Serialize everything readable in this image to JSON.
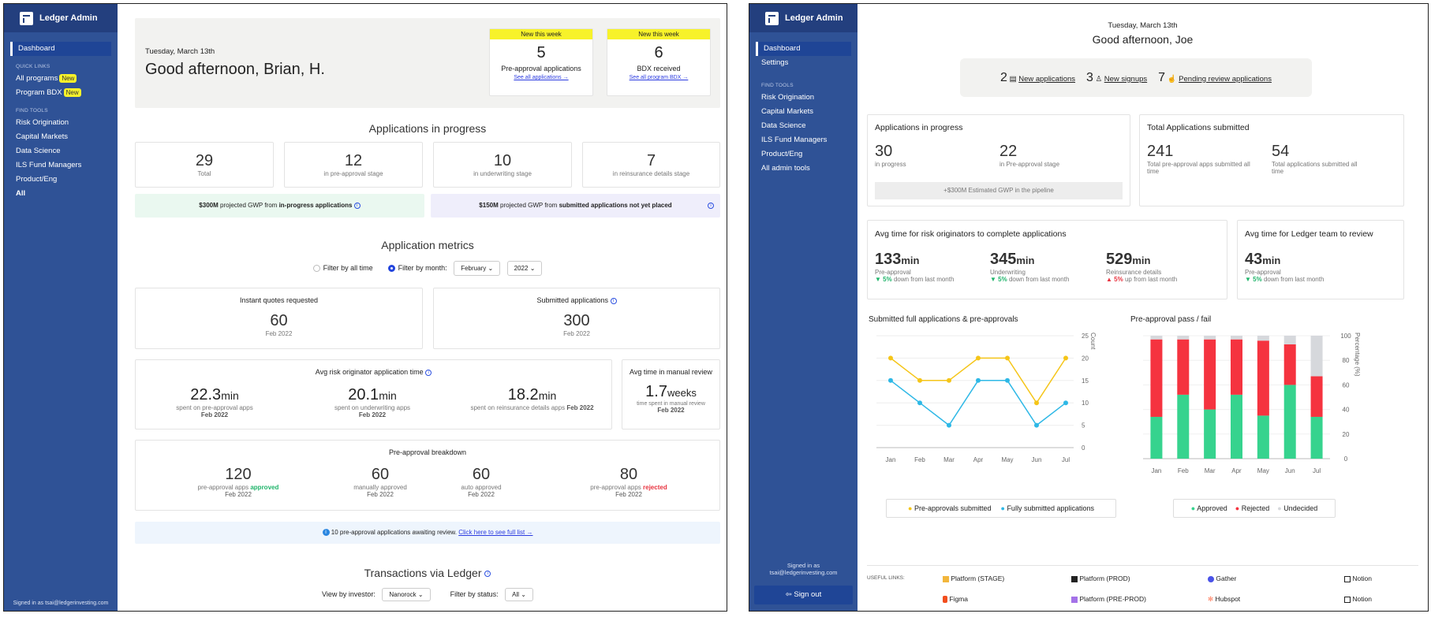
{
  "left": {
    "app_name": "Ledger Admin",
    "nav_dashboard": "Dashboard",
    "quick_links_heading": "QUICK LINKS",
    "quick_links": [
      {
        "label": "All programs",
        "badge": "New"
      },
      {
        "label": "Program BDX",
        "badge": "New"
      }
    ],
    "find_tools_heading": "FIND TOOLS",
    "tools": [
      "Risk Origination",
      "Capital Markets",
      "Data Science",
      "ILS Fund Managers",
      "Product/Eng",
      "All"
    ],
    "signed_in": "Signed in as tsai@ledgerinvesting.com",
    "date": "Tuesday, March 13th",
    "greeting": "Good afternoon, Brian, H.",
    "weekly": [
      {
        "tag": "New this week",
        "value": "5",
        "label": "Pre-approval applications",
        "link": "See all applications →"
      },
      {
        "tag": "New this week",
        "value": "6",
        "label": "BDX received",
        "link": "See all program BDX →"
      }
    ],
    "progress_title": "Applications in progress",
    "progress_stats": [
      {
        "value": "29",
        "label": "Total"
      },
      {
        "value": "12",
        "label": "in pre-approval stage"
      },
      {
        "value": "10",
        "label": "in underwriting stage"
      },
      {
        "value": "7",
        "label": "in reinsurance details stage"
      }
    ],
    "gwp_green": {
      "amount": "$300M",
      "mid": "projected GWP from",
      "bold": "in-progress applications"
    },
    "gwp_purple": {
      "amount": "$150M",
      "mid": "projected GWP from",
      "bold": "submitted applications not yet placed"
    },
    "metrics_title": "Application metrics",
    "filter_all": "Filter by all time",
    "filter_month": "Filter by month:",
    "month_value": "February",
    "year_value": "2022",
    "instant_quotes": {
      "title": "Instant quotes requested",
      "value": "60",
      "period": "Feb 2022"
    },
    "submitted_apps": {
      "title": "Submitted applications",
      "value": "300",
      "period": "Feb 2022"
    },
    "avg_originator": {
      "title": "Avg risk originator application time",
      "items": [
        {
          "value": "22.3",
          "unit": "min",
          "label": "spent on pre-approval apps",
          "period": "Feb 2022"
        },
        {
          "value": "20.1",
          "unit": "min",
          "label": "spent on underwriting apps",
          "period": "Feb 2022"
        },
        {
          "value": "18.2",
          "unit": "min",
          "label": "spent on reinsurance details apps",
          "period": "Feb 2022"
        }
      ]
    },
    "manual_review": {
      "title": "Avg time in manual review",
      "value": "1.7",
      "unit": "weeks",
      "label": "time spent in manual review",
      "period": "Feb 2022"
    },
    "breakdown": {
      "title": "Pre-approval breakdown",
      "items": [
        {
          "value": "120",
          "label": "pre-approval apps",
          "accent": "approved",
          "period": "Feb 2022"
        },
        {
          "value": "60",
          "label": "manually approved",
          "accent": "",
          "period": "Feb 2022"
        },
        {
          "value": "60",
          "label": "auto approved",
          "accent": "",
          "period": "Feb 2022"
        },
        {
          "value": "80",
          "label": "pre-approval apps",
          "accent": "rejected",
          "period": "Feb 2022"
        }
      ]
    },
    "review_notice": "10 pre-approval applications awaiting review.",
    "review_link": "Click here to see full list →",
    "transactions_title": "Transactions via Ledger",
    "view_by_investor": "View by investor:",
    "investor_value": "Nanorock",
    "filter_by_status": "Filter by status:",
    "status_value": "All"
  },
  "right": {
    "app_name": "Ledger Admin",
    "nav": [
      "Dashboard",
      "Settings"
    ],
    "find_tools_heading": "FIND TOOLS",
    "tools": [
      "Risk Origination",
      "Capital Markets",
      "Data Science",
      "ILS Fund Managers",
      "Product/Eng",
      "All admin tools"
    ],
    "signed_in_label": "Signed in as",
    "signed_in_email": "tsai@ledgerinvesting.com",
    "sign_out": "Sign out",
    "date": "Tuesday, March 13th",
    "greeting": "Good afternoon, Joe",
    "pills": [
      {
        "count": "2",
        "label": "New applications"
      },
      {
        "count": "3",
        "label": "New signups"
      },
      {
        "count": "7",
        "label": "Pending review applications"
      }
    ],
    "in_progress": {
      "title": "Applications in progress",
      "stats": [
        {
          "value": "30",
          "label": "in progress"
        },
        {
          "value": "22",
          "label": "in Pre-approval stage"
        }
      ],
      "gwp": "+$300M Estimated GWP in the pipeline"
    },
    "submitted": {
      "title": "Total Applications submitted",
      "stats": [
        {
          "value": "241",
          "label": "Total pre-approval apps submitted all time"
        },
        {
          "value": "54",
          "label": "Total applications submitted all time"
        }
      ]
    },
    "avg_originators": {
      "title": "Avg time for risk originators to complete applications",
      "stats": [
        {
          "value": "133",
          "unit": "min",
          "label": "Pre-approval",
          "change": "5%",
          "dir": "down",
          "note": "down from last month"
        },
        {
          "value": "345",
          "unit": "min",
          "label": "Underwriting",
          "change": "5%",
          "dir": "down",
          "note": "down from last month"
        },
        {
          "value": "529",
          "unit": "min",
          "label": "Reinsurance details",
          "change": "5%",
          "dir": "up",
          "note": "up from last month"
        }
      ]
    },
    "avg_ledger": {
      "title": "Avg time for Ledger team to review",
      "value": "43",
      "unit": "min",
      "label": "Pre-approval",
      "change": "5%",
      "note": "down from last month"
    },
    "useful_links_heading": "USEFUL LINKS:",
    "useful_links": [
      "Platform (STAGE)",
      "Platform (PROD)",
      "Gather",
      "Notion",
      "Figma",
      "Platform (PRE-PROD)",
      "Hubspot",
      "Notion"
    ]
  },
  "chart_data": [
    {
      "type": "line",
      "title": "Submitted full applications & pre-approvals",
      "categories": [
        "Jan",
        "Feb",
        "Mar",
        "Apr",
        "May",
        "Jun",
        "Jul"
      ],
      "ylabel": "Count",
      "ylim": [
        0,
        25
      ],
      "yticks": [
        0,
        5,
        10,
        15,
        20,
        25
      ],
      "grid": true,
      "legend": "bottom",
      "series": [
        {
          "name": "Pre-approvals submitted",
          "color": "#f5c518",
          "values": [
            20,
            15,
            15,
            20,
            20,
            10,
            20
          ]
        },
        {
          "name": "Fully submitted applications",
          "color": "#2eb8e6",
          "values": [
            15,
            10,
            5,
            15,
            15,
            5,
            10
          ]
        }
      ]
    },
    {
      "type": "bar",
      "stacked": true,
      "title": "Pre-approval pass / fail",
      "categories": [
        "Jan",
        "Feb",
        "Mar",
        "Apr",
        "May",
        "Jun",
        "Jul"
      ],
      "ylabel": "Percentage (%)",
      "ylim": [
        0,
        100
      ],
      "yticks": [
        0,
        20,
        40,
        60,
        80,
        100
      ],
      "legend": "bottom",
      "series": [
        {
          "name": "Approved",
          "color": "#36d38e",
          "values": [
            34,
            52,
            40,
            52,
            35,
            60,
            34
          ]
        },
        {
          "name": "Rejected",
          "color": "#f5333f",
          "values": [
            63,
            45,
            57,
            45,
            61,
            33,
            33
          ]
        },
        {
          "name": "Undecided",
          "color": "#d6d8dc",
          "values": [
            3,
            3,
            3,
            3,
            4,
            7,
            33
          ]
        }
      ]
    }
  ]
}
